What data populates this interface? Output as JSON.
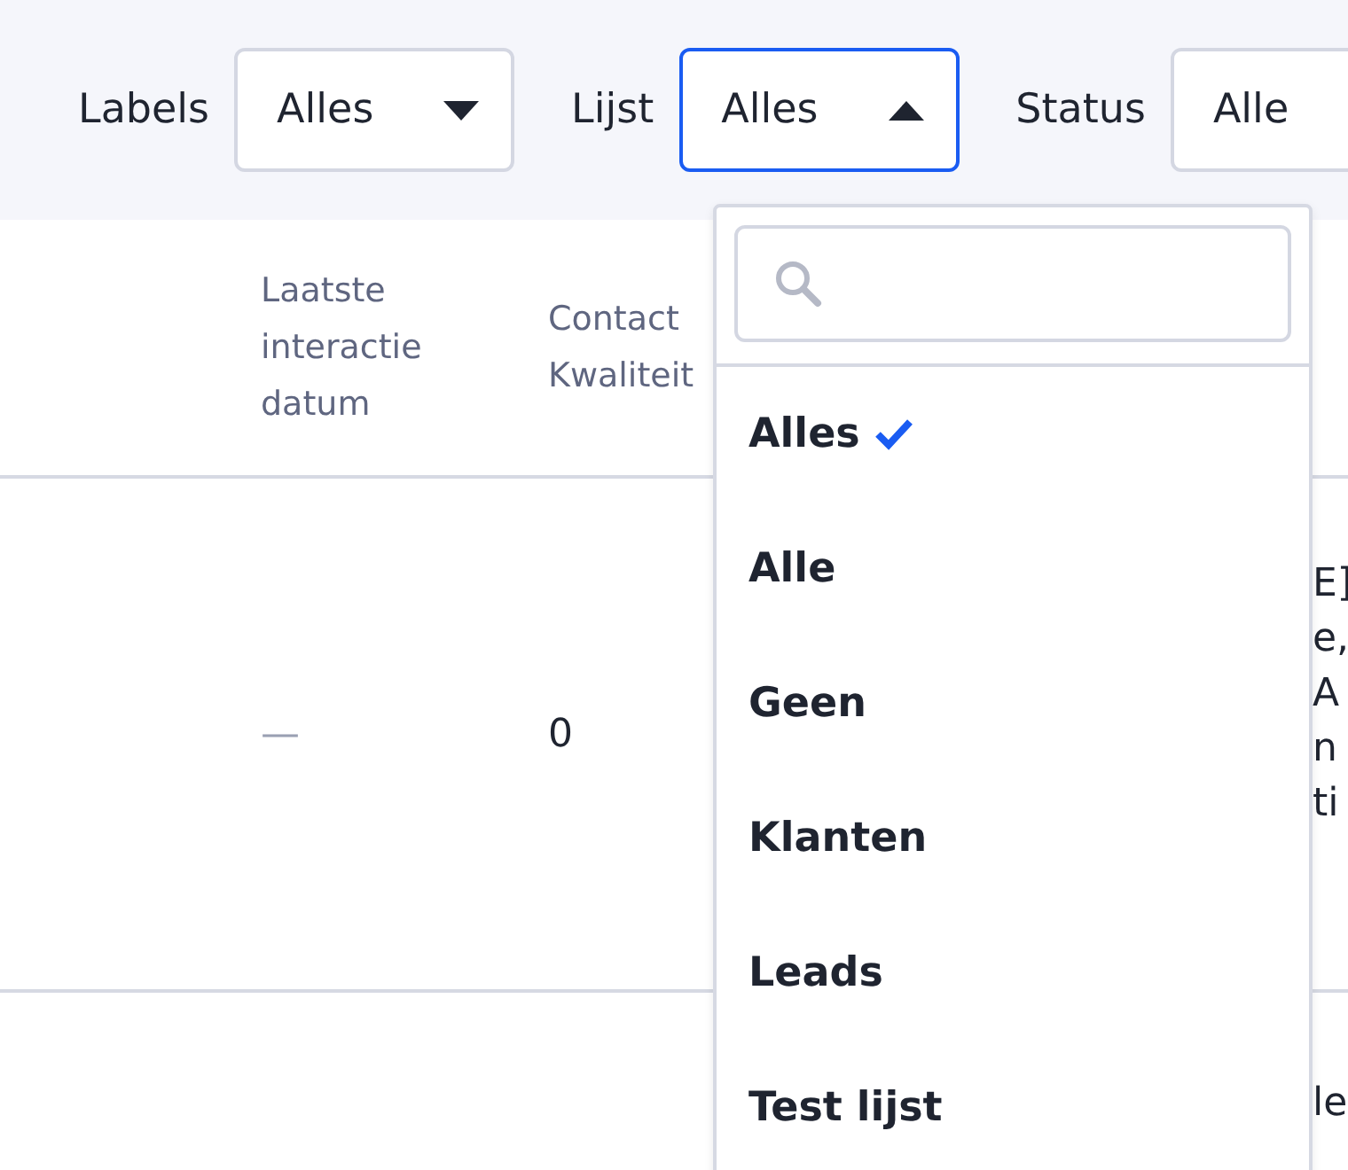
{
  "filters": [
    {
      "label": "Labels",
      "value": "Alles",
      "open": false
    },
    {
      "label": "Lijst",
      "value": "Alles",
      "open": true
    },
    {
      "label": "Status",
      "value": "Alle",
      "open": false
    }
  ],
  "dropdown": {
    "items": [
      {
        "label": "Alles",
        "selected": true
      },
      {
        "label": "Alle",
        "selected": false
      },
      {
        "label": "Geen",
        "selected": false
      },
      {
        "label": "Klanten",
        "selected": false
      },
      {
        "label": "Leads",
        "selected": false
      },
      {
        "label": "Test lijst",
        "selected": false
      }
    ]
  },
  "table": {
    "columns": [
      "Laatste interactie datum",
      "Contact Kwaliteit"
    ],
    "rows": [
      {
        "cells": [
          "—",
          "0"
        ],
        "column_3": [
          "E]",
          "e,",
          "A",
          "n",
          "ti"
        ]
      },
      {
        "cells": [],
        "column_3": [
          "le"
        ]
      }
    ]
  }
}
